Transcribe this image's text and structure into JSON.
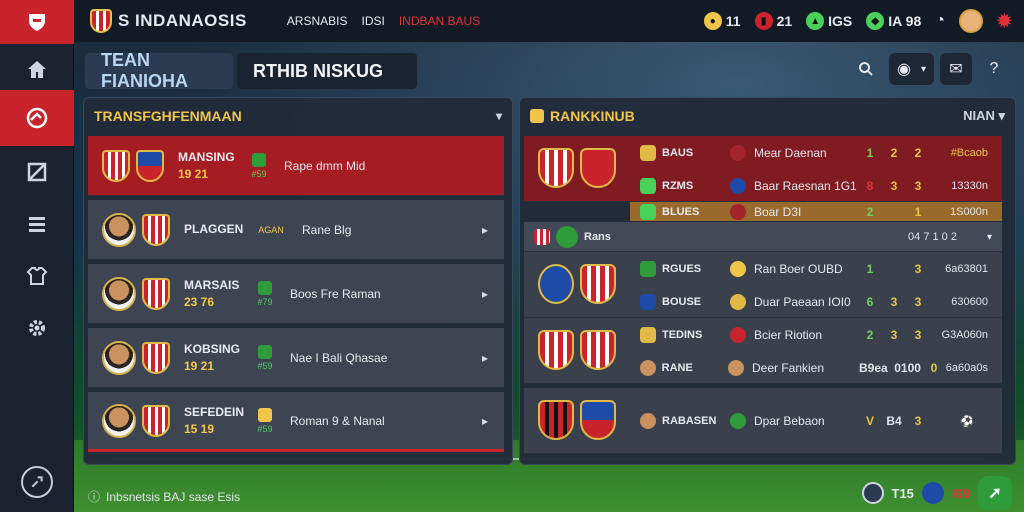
{
  "colors": {
    "accent": "#c9242b",
    "gold": "#f0c54a",
    "green": "#49d15a"
  },
  "brand": {
    "title": "S INDANAOSIS"
  },
  "topnav": {
    "item1": "ARSNABIS",
    "item2": "IDSI",
    "item3": "INDBAN BAUS"
  },
  "resources": {
    "coins": "11",
    "red": "21",
    "green1": "IGS",
    "green2": "IA 98"
  },
  "tabs": {
    "team": "TEAN FIANIOHA",
    "other": "RTHIB NISKUG"
  },
  "tools": {
    "search": "search-icon",
    "help": "?"
  },
  "transfers": {
    "title": "TRANSFGHFENMAAN",
    "rows": [
      {
        "name": "MANSING",
        "nums": "19 21",
        "badge": "#59",
        "info": "Rape dmm Mid"
      },
      {
        "name": "PLAGGEN",
        "nums": "",
        "badge": "AGAN",
        "info": "Rane Blg"
      },
      {
        "name": "MARSAIS",
        "nums": "23 76",
        "badge": "#79",
        "info": "Boos Fre Raman"
      },
      {
        "name": "KOBSING",
        "nums": "19 21",
        "badge": "#59",
        "info": "Nae I Bali Qhasae"
      },
      {
        "name": "SEFEDEIN",
        "nums": "15 19",
        "badge": "#59",
        "info": "Roman 9 & Nanal"
      }
    ]
  },
  "rankings": {
    "title": "RANKKINUB",
    "filter": "NIAN",
    "rows": [
      {
        "team": "BAUS",
        "desc": "Mear Daenan",
        "n1": "1",
        "n2": "2",
        "n3": "2",
        "pts": "#Bcaob"
      },
      {
        "team": "RZMS",
        "desc": "Baar Raesnan 1G1",
        "n1": "8",
        "n2": "3",
        "n3": "3",
        "pts": "13330n"
      },
      {
        "team": "BLUES",
        "desc": "Boar D3I",
        "n1": "2",
        "n2": "",
        "n3": "1",
        "pts": "1S000n"
      },
      {
        "team": "Rans",
        "desc": "",
        "n1": "",
        "n2": "",
        "n3": "",
        "pts": "04 7 1 0 2"
      },
      {
        "team": "RGUES",
        "desc": "Ran Boer OUBD",
        "n1": "1",
        "n2": "",
        "n3": "3",
        "pts": "6a63801"
      },
      {
        "team": "BOUSE",
        "desc": "Duar Paeaan IOI0",
        "n1": "6",
        "n2": "3",
        "n3": "3",
        "pts": "630600"
      },
      {
        "team": "TEDINS",
        "desc": "Bcier Riotion",
        "n1": "2",
        "n2": "3",
        "n3": "3",
        "pts": "G3A060n"
      },
      {
        "team": "RANE",
        "desc": "Deer Fankien",
        "n1": "B9ea",
        "n2": "0100",
        "n3": "0",
        "pts": "6a60a0s"
      },
      {
        "team": "RABASEN",
        "desc": "Dpar Bebaon",
        "n1": "V",
        "n2": "B4",
        "n3": "3",
        "pts": ""
      }
    ]
  },
  "footer": {
    "left": "Inbsnetsis BAJ sase Esis",
    "score1": "T15",
    "score2": "I09"
  }
}
